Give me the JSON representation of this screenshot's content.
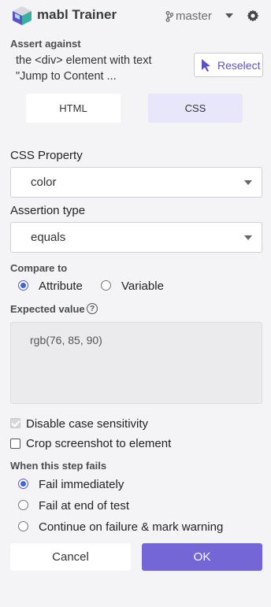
{
  "header": {
    "title": "mabl Trainer",
    "branch": "master",
    "icons": [
      "mabl-logo",
      "branch-icon",
      "chevron-down-icon",
      "gear-icon"
    ]
  },
  "assert_against": {
    "label": "Assert against",
    "target_text": "the <div> element with text \"Jump to Content ...",
    "reselect_label": "Reselect"
  },
  "mode_toggle": {
    "html_label": "HTML",
    "css_label": "CSS",
    "selected": "CSS"
  },
  "css_property": {
    "label": "CSS Property",
    "value": "color"
  },
  "assertion_type": {
    "label": "Assertion type",
    "value": "equals"
  },
  "compare_to": {
    "label": "Compare to",
    "options": [
      "Attribute",
      "Variable"
    ],
    "selected": "Attribute"
  },
  "expected_value": {
    "label": "Expected value",
    "value": "rgb(76, 85, 90)"
  },
  "options": {
    "disable_case_sensitivity": "Disable case sensitivity",
    "crop_screenshot": "Crop screenshot to element"
  },
  "on_failure": {
    "label": "When this step fails",
    "options": [
      "Fail immediately",
      "Fail at end of test",
      "Continue on failure & mark warning"
    ],
    "selected": "Fail immediately"
  },
  "actions": {
    "cancel_label": "Cancel",
    "ok_label": "OK"
  },
  "colors": {
    "accent": "#7466d4",
    "accent_light": "#e8e6fa",
    "radio_selected": "#3a66d8",
    "background": "#f4f4f6"
  }
}
